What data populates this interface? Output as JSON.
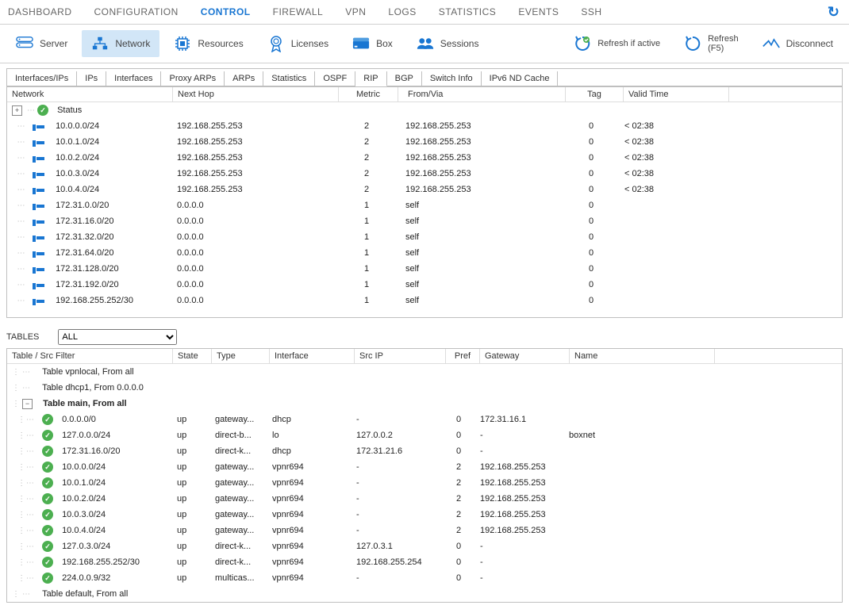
{
  "menu": {
    "items": [
      "DASHBOARD",
      "CONFIGURATION",
      "CONTROL",
      "FIREWALL",
      "VPN",
      "LOGS",
      "STATISTICS",
      "EVENTS",
      "SSH"
    ],
    "active": 2
  },
  "toolbar": {
    "server": "Server",
    "network": "Network",
    "resources": "Resources",
    "licenses": "Licenses",
    "box": "Box",
    "sessions": "Sessions",
    "refresh_if": "Refresh if active",
    "refresh_f5_l1": "Refresh",
    "refresh_f5_l2": "(F5)",
    "disconnect": "Disconnect"
  },
  "subtabs": {
    "items": [
      "Interfaces/IPs",
      "IPs",
      "Interfaces",
      "Proxy ARPs",
      "ARPs",
      "Statistics",
      "OSPF",
      "RIP",
      "BGP",
      "Switch Info",
      "IPv6 ND Cache"
    ],
    "active": 7
  },
  "rip": {
    "headers": {
      "network": "Network",
      "nexthop": "Next Hop",
      "metric": "Metric",
      "fromvia": "From/Via",
      "tag": "Tag",
      "validtime": "Valid Time"
    },
    "status_label": "Status",
    "rows": [
      {
        "net": "10.0.0.0/24",
        "nh": "192.168.255.253",
        "m": "2",
        "fv": "192.168.255.253",
        "tag": "0",
        "vt": "< 02:38"
      },
      {
        "net": "10.0.1.0/24",
        "nh": "192.168.255.253",
        "m": "2",
        "fv": "192.168.255.253",
        "tag": "0",
        "vt": "< 02:38"
      },
      {
        "net": "10.0.2.0/24",
        "nh": "192.168.255.253",
        "m": "2",
        "fv": "192.168.255.253",
        "tag": "0",
        "vt": "< 02:38"
      },
      {
        "net": "10.0.3.0/24",
        "nh": "192.168.255.253",
        "m": "2",
        "fv": "192.168.255.253",
        "tag": "0",
        "vt": "< 02:38"
      },
      {
        "net": "10.0.4.0/24",
        "nh": "192.168.255.253",
        "m": "2",
        "fv": "192.168.255.253",
        "tag": "0",
        "vt": "< 02:38"
      },
      {
        "net": "172.31.0.0/20",
        "nh": "0.0.0.0",
        "m": "1",
        "fv": "self",
        "tag": "0",
        "vt": ""
      },
      {
        "net": "172.31.16.0/20",
        "nh": "0.0.0.0",
        "m": "1",
        "fv": "self",
        "tag": "0",
        "vt": ""
      },
      {
        "net": "172.31.32.0/20",
        "nh": "0.0.0.0",
        "m": "1",
        "fv": "self",
        "tag": "0",
        "vt": ""
      },
      {
        "net": "172.31.64.0/20",
        "nh": "0.0.0.0",
        "m": "1",
        "fv": "self",
        "tag": "0",
        "vt": ""
      },
      {
        "net": "172.31.128.0/20",
        "nh": "0.0.0.0",
        "m": "1",
        "fv": "self",
        "tag": "0",
        "vt": ""
      },
      {
        "net": "172.31.192.0/20",
        "nh": "0.0.0.0",
        "m": "1",
        "fv": "self",
        "tag": "0",
        "vt": ""
      },
      {
        "net": "192.168.255.252/30",
        "nh": "0.0.0.0",
        "m": "1",
        "fv": "self",
        "tag": "0",
        "vt": ""
      }
    ]
  },
  "tables": {
    "label": "TABLES",
    "filter": "ALL",
    "headers": {
      "tsf": "Table / Src Filter",
      "state": "State",
      "type": "Type",
      "iface": "Interface",
      "src": "Src IP",
      "pref": "Pref",
      "gw": "Gateway",
      "name": "Name"
    },
    "groups": [
      {
        "label": "Table vpnlocal, From all",
        "expanded": false,
        "bold": false,
        "rows": []
      },
      {
        "label": "Table dhcp1, From 0.0.0.0",
        "expanded": false,
        "bold": false,
        "rows": []
      },
      {
        "label": "Table main, From all",
        "expanded": true,
        "bold": true,
        "rows": [
          {
            "net": "0.0.0.0/0",
            "state": "up",
            "type": "gateway...",
            "if": "dhcp",
            "src": "-",
            "pref": "0",
            "gw": "172.31.16.1",
            "name": ""
          },
          {
            "net": "127.0.0.0/24",
            "state": "up",
            "type": "direct-b...",
            "if": "lo",
            "src": "127.0.0.2",
            "pref": "0",
            "gw": "-",
            "name": "boxnet"
          },
          {
            "net": "172.31.16.0/20",
            "state": "up",
            "type": "direct-k...",
            "if": "dhcp",
            "src": "172.31.21.6",
            "pref": "0",
            "gw": "-",
            "name": ""
          },
          {
            "net": "10.0.0.0/24",
            "state": "up",
            "type": "gateway...",
            "if": "vpnr694",
            "src": "-",
            "pref": "2",
            "gw": "192.168.255.253",
            "name": ""
          },
          {
            "net": "10.0.1.0/24",
            "state": "up",
            "type": "gateway...",
            "if": "vpnr694",
            "src": "-",
            "pref": "2",
            "gw": "192.168.255.253",
            "name": ""
          },
          {
            "net": "10.0.2.0/24",
            "state": "up",
            "type": "gateway...",
            "if": "vpnr694",
            "src": "-",
            "pref": "2",
            "gw": "192.168.255.253",
            "name": ""
          },
          {
            "net": "10.0.3.0/24",
            "state": "up",
            "type": "gateway...",
            "if": "vpnr694",
            "src": "-",
            "pref": "2",
            "gw": "192.168.255.253",
            "name": ""
          },
          {
            "net": "10.0.4.0/24",
            "state": "up",
            "type": "gateway...",
            "if": "vpnr694",
            "src": "-",
            "pref": "2",
            "gw": "192.168.255.253",
            "name": ""
          },
          {
            "net": "127.0.3.0/24",
            "state": "up",
            "type": "direct-k...",
            "if": "vpnr694",
            "src": "127.0.3.1",
            "pref": "0",
            "gw": "-",
            "name": ""
          },
          {
            "net": "192.168.255.252/30",
            "state": "up",
            "type": "direct-k...",
            "if": "vpnr694",
            "src": "192.168.255.254",
            "pref": "0",
            "gw": "-",
            "name": ""
          },
          {
            "net": "224.0.0.9/32",
            "state": "up",
            "type": "multicas...",
            "if": "vpnr694",
            "src": "-",
            "pref": "0",
            "gw": "-",
            "name": ""
          }
        ]
      },
      {
        "label": "Table default, From all",
        "expanded": false,
        "bold": false,
        "rows": []
      }
    ]
  }
}
